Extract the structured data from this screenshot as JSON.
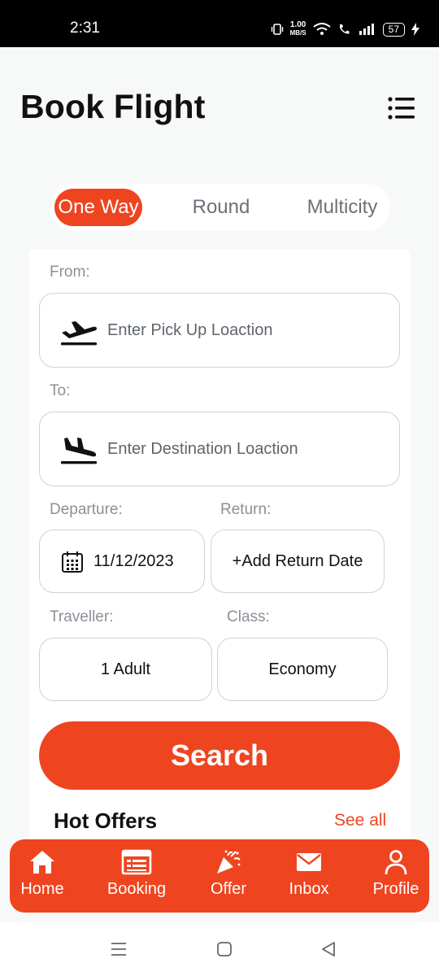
{
  "status_bar": {
    "time": "2:31",
    "net_speed_value": "1.00",
    "net_speed_unit": "MB/S",
    "battery": "57"
  },
  "header": {
    "title": "Book Flight",
    "menu_icon": "list-menu-icon"
  },
  "trip_tabs": [
    {
      "label": "One Way",
      "active": true
    },
    {
      "label": "Round",
      "active": false
    },
    {
      "label": "Multicity",
      "active": false
    }
  ],
  "form": {
    "from_label": "From:",
    "from_placeholder": "Enter Pick Up Loaction",
    "from_icon": "flight-takeoff-icon",
    "to_label": "To:",
    "to_placeholder": "Enter Destination Loaction",
    "to_icon": "flight-land-icon",
    "departure_label": "Departure:",
    "departure_value": "11/12/2023",
    "departure_icon": "calendar-icon",
    "return_label": "Return:",
    "return_value": "+Add Return Date",
    "traveller_label": "Traveller:",
    "traveller_value": "1 Adult",
    "class_label": "Class:",
    "class_value": "Economy",
    "search_label": "Search"
  },
  "hot_offers": {
    "title": "Hot Offers",
    "see_all": "See all"
  },
  "bottom_nav": [
    {
      "label": "Home",
      "icon": "home-icon"
    },
    {
      "label": "Booking",
      "icon": "booking-icon"
    },
    {
      "label": "Offer",
      "icon": "party-popper-icon"
    },
    {
      "label": "Inbox",
      "icon": "mail-icon"
    },
    {
      "label": "Profile",
      "icon": "person-icon"
    }
  ],
  "colors": {
    "accent": "#ee4520",
    "background": "#f7f8f8",
    "card": "#ffffff",
    "label_gray": "#8b9097"
  }
}
